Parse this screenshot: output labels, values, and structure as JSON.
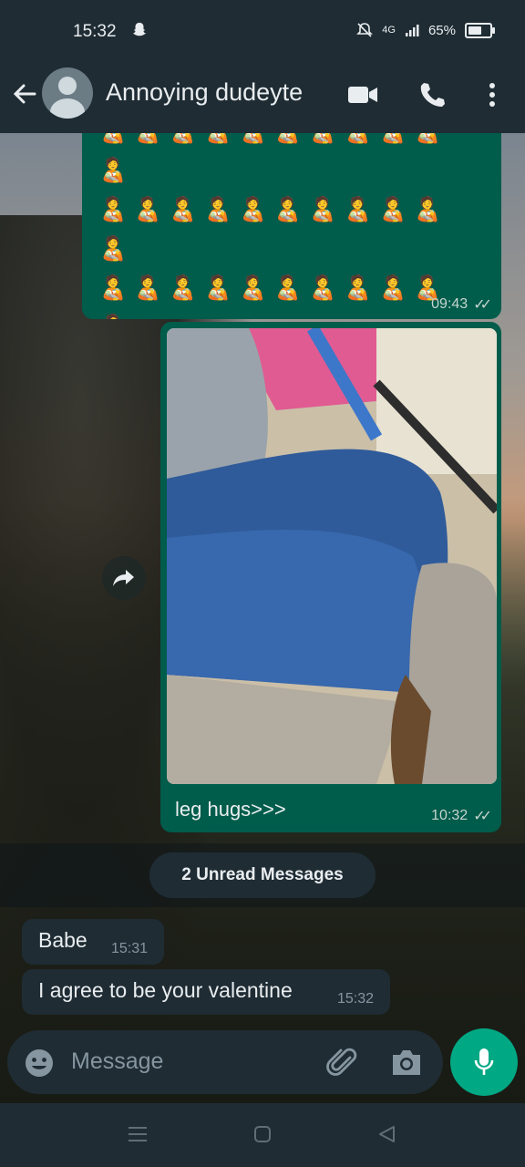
{
  "status_bar": {
    "time": "15:32",
    "network": "4G",
    "battery_text": "65%",
    "battery_level": 0.65
  },
  "header": {
    "contact_name": "Annoying dudeyte"
  },
  "messages": {
    "emoji_msg": {
      "emoji": "🧑‍🍼",
      "rows": 5,
      "time": "09:43"
    },
    "photo_msg": {
      "caption": "leg hugs>>>",
      "time": "10:32"
    }
  },
  "unread_label": "2 Unread Messages",
  "incoming": [
    {
      "text": "Babe",
      "time": "15:31"
    },
    {
      "text": "I agree to be your valentine",
      "time": "15:32"
    }
  ],
  "input": {
    "placeholder": "Message"
  },
  "colors": {
    "outgoing": "#005c4b",
    "incoming": "#1f2c34",
    "accent": "#00a884",
    "bar": "#1f2c34"
  }
}
